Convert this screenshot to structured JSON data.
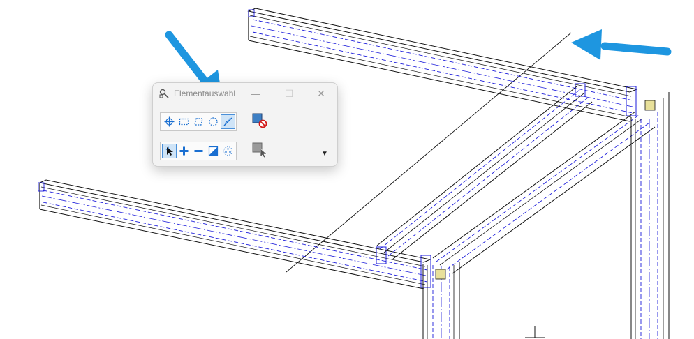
{
  "window": {
    "title": "Elementauswahl",
    "minimize_glyph": "—",
    "maximize_glyph": "☐",
    "close_glyph": "✕"
  },
  "tools": {
    "method_group": [
      "crosshair-icon",
      "rectangle-select-icon",
      "polygon-select-icon",
      "circle-select-icon",
      "line-select-icon"
    ],
    "active_method": "line-select-icon",
    "mode_group": [
      "pointer-icon",
      "add-icon",
      "subtract-icon",
      "invert-icon",
      "radial-select-icon"
    ],
    "active_mode": "pointer-icon"
  },
  "buttons": {
    "clear_selection_icon": "clear-selection-icon",
    "select_all_icon": "select-pointer-icon",
    "dropdown_glyph": "▼"
  },
  "colors": {
    "accent": "#1e96e0",
    "wireframe": "#1a1a1a",
    "hidden_lines": "#1d1ddb",
    "connection_plate": "#e8e09a",
    "active_tool": "#cfe4f7"
  },
  "annotations": [
    "arrow pointing to line selection tool",
    "arrow pointing to drawn line in viewport"
  ]
}
